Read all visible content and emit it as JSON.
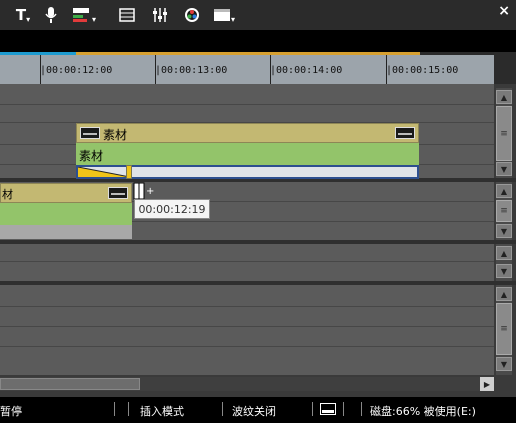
{
  "toolbar": {
    "items": [
      {
        "icon": "text-title-icon",
        "glyph": "T"
      },
      {
        "icon": "microphone-icon",
        "glyph": "🎤"
      },
      {
        "icon": "overlay-track-icon",
        "glyph": "▤"
      },
      {
        "icon": "multicam-icon",
        "glyph": "▦"
      },
      {
        "icon": "audio-mixer-icon",
        "glyph": "⫶"
      },
      {
        "icon": "color-correct-icon",
        "glyph": "◉"
      },
      {
        "icon": "window-layout-icon",
        "glyph": "▬"
      }
    ],
    "close_glyph": "×"
  },
  "ruler": {
    "labels": [
      "|00:00:12:00",
      "|00:00:13:00",
      "|00:00:14:00",
      "|00:00:15:00"
    ]
  },
  "clips": {
    "upper_title": "素材",
    "upper_body": "素材"
  },
  "tooltip": {
    "timecode": "00:00:12:19"
  },
  "status": {
    "left": "暂停",
    "insert_mode": "插入模式",
    "ripple": "波纹关闭",
    "disk": "磁盘:66% 被使用(E:)"
  },
  "colors": {
    "clip_header": "#c3b872",
    "clip_body": "#93c46a",
    "ruler_bg": "#9ca4ab",
    "accent_blue": "#1d9bd0",
    "accent_orange": "#d7a030"
  }
}
